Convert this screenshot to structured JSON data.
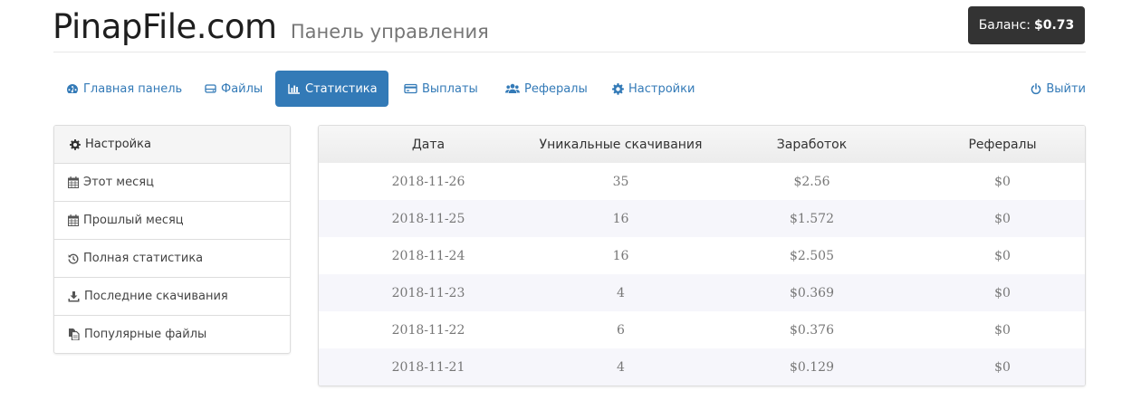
{
  "header": {
    "brand": "PinapFile.com",
    "subtitle": "Панель управления",
    "balance_label": "Баланс:",
    "balance_value": "$0.73"
  },
  "nav": {
    "items": [
      {
        "label": "Главная панель",
        "icon": "dashboard-icon"
      },
      {
        "label": "Файлы",
        "icon": "hdd-icon"
      },
      {
        "label": "Статистика",
        "icon": "bar-chart-icon",
        "active": true
      },
      {
        "label": "Выплаты",
        "icon": "credit-card-icon"
      },
      {
        "label": "Рефералы",
        "icon": "users-icon"
      },
      {
        "label": "Настройки",
        "icon": "gear-icon"
      }
    ],
    "logout": {
      "label": "Выйти",
      "icon": "power-icon"
    }
  },
  "sidebar": {
    "header": {
      "label": "Настройка",
      "icon": "gear-icon"
    },
    "items": [
      {
        "label": "Этот месяц",
        "icon": "calendar-icon"
      },
      {
        "label": "Прошлый месяц",
        "icon": "calendar-icon"
      },
      {
        "label": "Полная статистика",
        "icon": "history-icon"
      },
      {
        "label": "Последние скачивания",
        "icon": "download-icon"
      },
      {
        "label": "Популярные файлы",
        "icon": "files-icon"
      }
    ]
  },
  "table": {
    "columns": [
      "Дата",
      "Уникальные скачивания",
      "Заработок",
      "Рефералы"
    ],
    "rows": [
      [
        "2018-11-26",
        "35",
        "$2.56",
        "$0"
      ],
      [
        "2018-11-25",
        "16",
        "$1.572",
        "$0"
      ],
      [
        "2018-11-24",
        "16",
        "$2.505",
        "$0"
      ],
      [
        "2018-11-23",
        "4",
        "$0.369",
        "$0"
      ],
      [
        "2018-11-22",
        "6",
        "$0.376",
        "$0"
      ],
      [
        "2018-11-21",
        "4",
        "$0.129",
        "$0"
      ]
    ]
  },
  "colors": {
    "primary": "#337ab7",
    "balance_bg": "#333333",
    "stripe": "#f6f6fb"
  }
}
